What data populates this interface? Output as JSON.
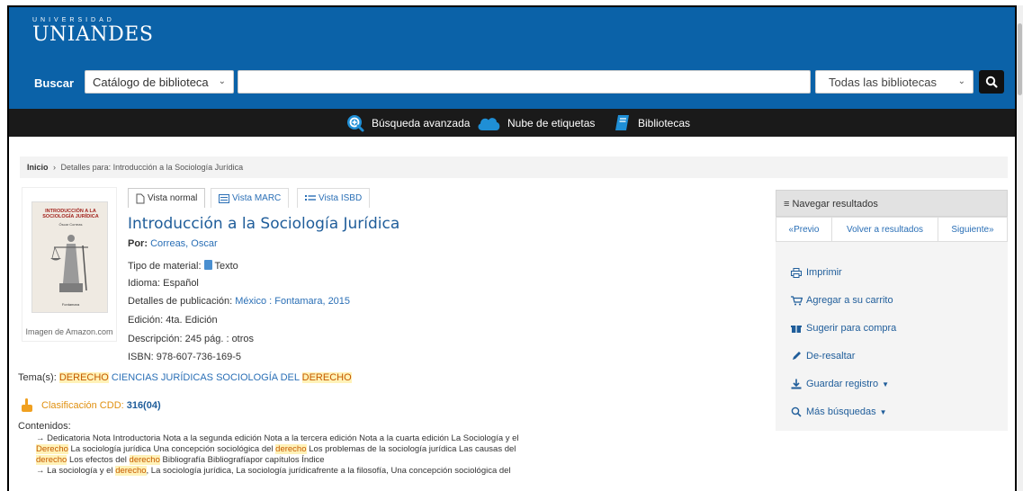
{
  "header": {
    "logo_top": "UNIVERSIDAD",
    "logo_main": "UNIANDES"
  },
  "search": {
    "label": "Buscar",
    "catalog_option": "Catálogo de biblioteca",
    "query_value": "",
    "library_option": "Todas las bibliotecas"
  },
  "nav": {
    "advanced": "Búsqueda avanzada",
    "tags": "Nube de etiquetas",
    "libraries": "Bibliotecas"
  },
  "breadcrumb": {
    "home": "Inicio",
    "separator": "›",
    "current": "Detalles para: Introducción a la Sociología Jurídica"
  },
  "cover": {
    "title_line": "INTRODUCCIÓN A LA SOCIOLOGÍA JURÍDICA",
    "author_line": "Óscar Correas",
    "publisher_line": "Fontamara",
    "caption": "Imagen de Amazon.com"
  },
  "tabs": [
    "Vista normal",
    "Vista MARC",
    "Vista ISBD"
  ],
  "record": {
    "title": "Introducción a la Sociología Jurídica",
    "by_label": "Por:",
    "author": "Correas, Oscar",
    "material_label": "Tipo de material:",
    "material_value": "Texto",
    "language": "Idioma: Español",
    "pub_label": "Detalles de publicación:",
    "pub_value": "México : Fontamara, 2015",
    "edition": "Edición: 4ta. Edición",
    "description": "Descripción: 245 pág. : otros",
    "isbn": "ISBN: 978-607-736-169-5"
  },
  "subjects": {
    "label": "Tema(s):",
    "s1": "DERECHO",
    "s2": "CIENCIAS JURÍDICAS",
    "s3a": "SOCIOLOGÍA DEL",
    "s3b": "DERECHO"
  },
  "classification": {
    "label": "Clasificación CDD:",
    "value": "316(04)"
  },
  "contents": {
    "label": "Contenidos:",
    "l1": "→ Dedicatoria Nota Introductoria Nota a la segunda edición Nota a la tercera edición Nota a la cuarta edición La Sociología y el",
    "l2a": "Derecho",
    "l2b": " La sociología jurídica Una concepción sociológica del ",
    "l2c": "derecho",
    "l2d": " Los problemas de la sociología jurídica Las causas del",
    "l3a": "derecho",
    "l3b": " Los efectos del ",
    "l3c": "derecho",
    "l3d": " Bibliografía Bibliografíapor capítulos Índice",
    "l4a": "→ La sociología y el ",
    "l4b": "derecho",
    "l4c": ", La sociología jurídica, La sociología jurídicafrente a la filosofía, Una concepción sociológica del"
  },
  "sidebar": {
    "heading": "Navegar resultados",
    "prev": "«Previo",
    "back": "Volver a resultados",
    "next": "Siguiente»",
    "print": "Imprimir",
    "cart": "Agregar a su carrito",
    "suggest": "Sugerir para compra",
    "unhighlight": "De-resaltar",
    "save": "Guardar registro",
    "more": "Más búsquedas"
  }
}
